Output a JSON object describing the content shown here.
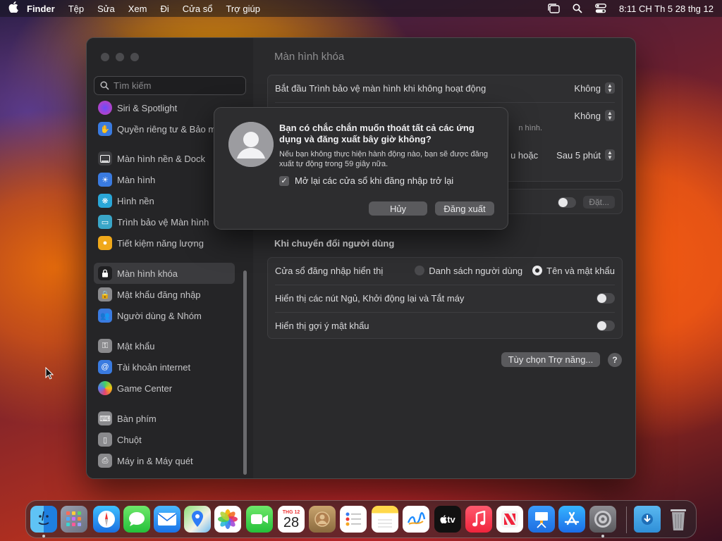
{
  "menubar": {
    "app_name": "Finder",
    "items": [
      "Tệp",
      "Sửa",
      "Xem",
      "Đi",
      "Cửa sổ",
      "Trợ giúp"
    ],
    "clock": "8:11 CH Th 5 28 thg 12"
  },
  "sidebar": {
    "search_placeholder": "Tìm kiếm",
    "items": [
      {
        "label": "Siri & Spotlight",
        "icon": "siri-icon"
      },
      {
        "label": "Quyền riêng tư & Bảo mật",
        "icon": "hand-icon"
      },
      {
        "label": "Màn hình nền & Dock",
        "icon": "desktop-dock-icon"
      },
      {
        "label": "Màn hình",
        "icon": "display-icon"
      },
      {
        "label": "Hình nền",
        "icon": "wallpaper-icon"
      },
      {
        "label": "Trình bảo vệ Màn hình",
        "icon": "screensaver-icon"
      },
      {
        "label": "Tiết kiệm năng lượng",
        "icon": "energy-icon"
      },
      {
        "label": "Màn hình khóa",
        "icon": "lock-screen-icon"
      },
      {
        "label": "Mật khẩu đăng nhập",
        "icon": "login-password-icon"
      },
      {
        "label": "Người dùng & Nhóm",
        "icon": "users-groups-icon"
      },
      {
        "label": "Mật khẩu",
        "icon": "key-icon"
      },
      {
        "label": "Tài khoản internet",
        "icon": "at-icon"
      },
      {
        "label": "Game Center",
        "icon": "game-center-icon"
      },
      {
        "label": "Bàn phím",
        "icon": "keyboard-icon"
      },
      {
        "label": "Chuột",
        "icon": "mouse-icon"
      },
      {
        "label": "Máy in & Máy quét",
        "icon": "printer-icon"
      }
    ]
  },
  "content": {
    "title": "Màn hình khóa",
    "rows": {
      "screensaver_label": "Bắt đầu Trình bảo vệ màn hình khi không hoạt động",
      "screensaver_value": "Không",
      "row2_value": "Không",
      "row2_sub": "n hình.",
      "row3_label_tail": "u hoặc",
      "row3_value": "Sau 5 phút",
      "row4_button": "Đặt..."
    },
    "switch_section": {
      "header": "Khi chuyển đổi người dùng",
      "login_window_label": "Cửa sổ đăng nhập hiển thị",
      "radio_list": "Danh sách người dùng",
      "radio_name_password": "Tên và mật khẩu",
      "show_buttons_label": "Hiển thị các nút Ngủ, Khởi động lại và Tắt máy",
      "show_hint_label": "Hiển thị gợi ý mật khẩu"
    },
    "accessibility_button": "Tùy chọn Trợ năng...",
    "help_button": "?"
  },
  "dialog": {
    "title": "Bạn có chắc chắn muốn thoát tất cả các ứng dụng và đăng xuất bây giờ không?",
    "message": "Nếu bạn không thực hiện hành động nào, bạn sẽ được đăng xuất tự động trong 59 giây nữa.",
    "checkbox_label": "Mở lại các cửa sổ khi đăng nhập trở lại",
    "checkbox_checked": true,
    "cancel_label": "Hủy",
    "logout_label": "Đăng xuất"
  },
  "dock": {
    "calendar_month": "THG 12",
    "calendar_day": "28",
    "tv_label": "tv"
  }
}
